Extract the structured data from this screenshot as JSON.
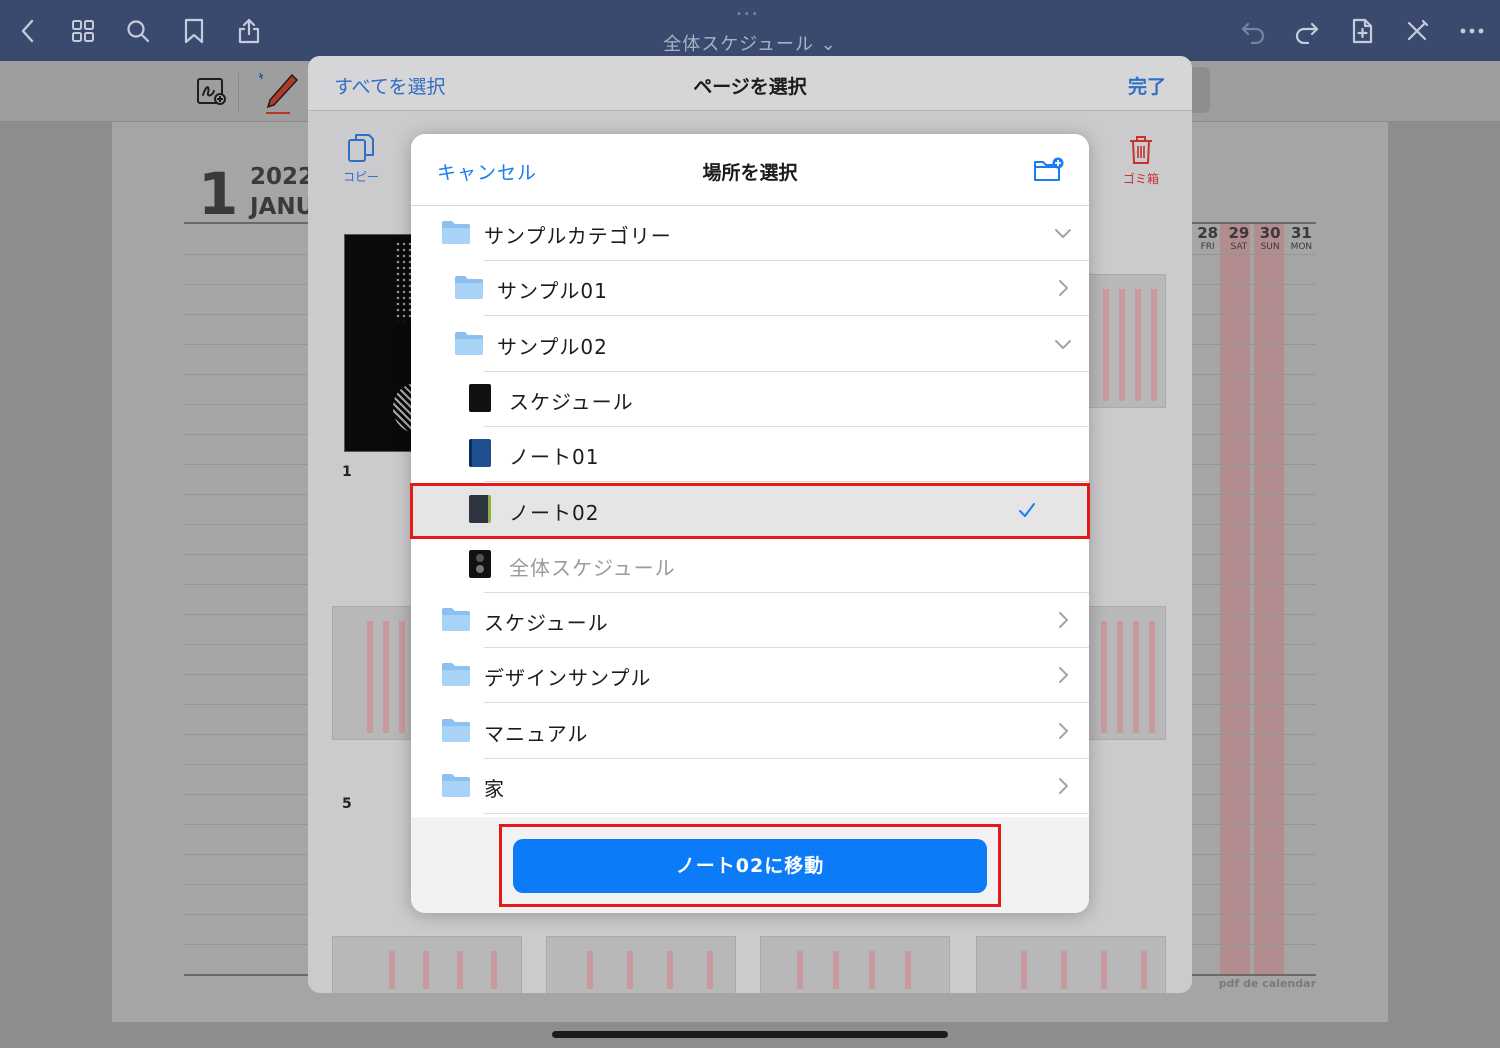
{
  "topbar": {
    "document_title": "全体スケジュール ⌄",
    "grab_dots": "•••"
  },
  "document": {
    "month_number": "1",
    "year": "2022",
    "month_name": "JANU",
    "days": [
      {
        "num": "28",
        "dow": "FRI"
      },
      {
        "num": "29",
        "dow": "SAT"
      },
      {
        "num": "30",
        "dow": "SUN"
      },
      {
        "num": "31",
        "dow": "MON"
      }
    ],
    "footer_brand": "pdf de calendar"
  },
  "page_sheet": {
    "select_all": "すべてを選択",
    "title": "ページを選択",
    "done": "完了",
    "copy_label": "コピー",
    "trash_label": "ゴミ箱",
    "page_numbers": [
      "1",
      "5"
    ]
  },
  "modal": {
    "cancel": "キャンセル",
    "title": "場所を選択",
    "items": [
      {
        "label": "サンプルカテゴリー",
        "type": "folder",
        "indent": 0,
        "disclosure": "expanded"
      },
      {
        "label": "サンプル01",
        "type": "folder",
        "indent": 1,
        "disclosure": "collapsed"
      },
      {
        "label": "サンプル02",
        "type": "folder",
        "indent": 1,
        "disclosure": "expanded"
      },
      {
        "label": "スケジュール",
        "type": "notebook",
        "indent": 2,
        "cover": "black"
      },
      {
        "label": "ノート01",
        "type": "notebook",
        "indent": 2,
        "cover": "blue"
      },
      {
        "label": "ノート02",
        "type": "notebook",
        "indent": 2,
        "cover": "dark-gray",
        "selected": true
      },
      {
        "label": "全体スケジュール",
        "type": "notebook",
        "indent": 2,
        "cover": "black",
        "disabled": true
      },
      {
        "label": "スケジュール",
        "type": "folder",
        "indent": 0,
        "disclosure": "collapsed"
      },
      {
        "label": "デザインサンプル",
        "type": "folder",
        "indent": 0,
        "disclosure": "collapsed"
      },
      {
        "label": "マニュアル",
        "type": "folder",
        "indent": 0,
        "disclosure": "collapsed"
      },
      {
        "label": "家",
        "type": "folder",
        "indent": 0,
        "disclosure": "collapsed"
      }
    ],
    "move_button": "ノート02に移動"
  },
  "colors": {
    "accent": "#1a7cf5",
    "button": "#0b7bf7",
    "highlight": "#e21a1a",
    "topbar": "#3a4a6e",
    "folder": "#8cc0f0"
  }
}
